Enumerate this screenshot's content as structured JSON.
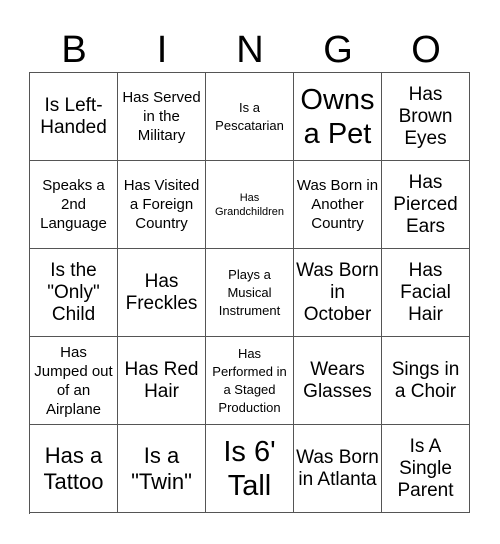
{
  "header": {
    "letters": [
      "B",
      "I",
      "N",
      "G",
      "O"
    ]
  },
  "cells": [
    [
      "Is Left-Handed",
      "Has Served in the Military",
      "Is a Pescatarian",
      "Owns a Pet",
      "Has Brown Eyes"
    ],
    [
      "Speaks a 2nd Language",
      "Has Visited a Foreign Country",
      "Has Grandchildren",
      "Was Born in Another Country",
      "Has Pierced Ears"
    ],
    [
      "Is the \"Only\" Child",
      "Has Freckles",
      "Plays a Musical Instrument",
      "Was Born in October",
      "Has Facial Hair"
    ],
    [
      "Has Jumped out of an Airplane",
      "Has Red Hair",
      "Has Performed in a Staged Production",
      "Wears Glasses",
      "Sings in a Choir"
    ],
    [
      "Has a Tattoo",
      "Is a \"Twin\"",
      "Is 6' Tall",
      "Was Born in Atlanta",
      "Is A Single Parent"
    ]
  ]
}
